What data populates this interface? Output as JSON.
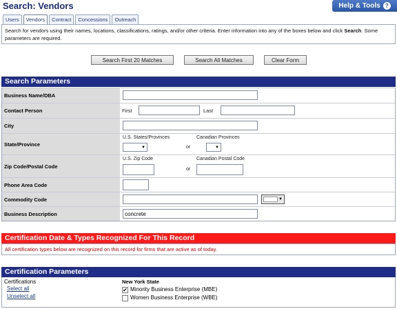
{
  "header": {
    "title": "Search: Vendors",
    "help_label": "Help & Tools",
    "help_icon": "?"
  },
  "tabs": [
    {
      "label": "Users",
      "active": false
    },
    {
      "label": "Vendors",
      "active": true
    },
    {
      "label": "Contract",
      "active": false
    },
    {
      "label": "Concessions",
      "active": false
    },
    {
      "label": "Outreach",
      "active": false
    }
  ],
  "intro": {
    "text_before": "Search for vendors using their names, locations, classifications, ratings, and/or other criteria. Enter information into any of the boxes below and click ",
    "bold_word": "Search",
    "text_after": ". Some parameters are required."
  },
  "actions": {
    "search_first": "Search First 20 Matches",
    "search_all": "Search All Matches",
    "clear": "Clear Form"
  },
  "search_params": {
    "heading": "Search Parameters",
    "business_name_label": "Business Name/DBA",
    "business_name_value": "",
    "contact_label": "Contact Person",
    "first_label": "First",
    "last_label": "Last",
    "city_label": "City",
    "state_label": "State/Province",
    "us_states_label": "U.S. States/Provinces",
    "canadian_provinces_label": "Canadian Provinces",
    "or_label": "or",
    "zip_label": "Zip Code/Postal Code",
    "us_zip_label": "U.S. Zip Code",
    "canadian_postal_label": "Canadian Postal Code",
    "phone_label": "Phone Area Code",
    "commodity_label": "Commodity Code",
    "description_label": "Business Description",
    "description_value": "concrete"
  },
  "cert_recognized": {
    "heading": "Certification Date & Types Recognized For This Record",
    "note": "All certification types below are recognized on this record for firms that are active as of today."
  },
  "cert_params": {
    "heading": "Certification Parameters",
    "certifications_label": "Certifications",
    "select_all": "Select all",
    "unselect_all": "Unselect all",
    "state_group": "New York State",
    "items": [
      {
        "label": "Minority Business Enterprise (MBE)",
        "checked": true
      },
      {
        "label": "Women Business Enterprise (WBE)",
        "checked": false
      }
    ]
  }
}
